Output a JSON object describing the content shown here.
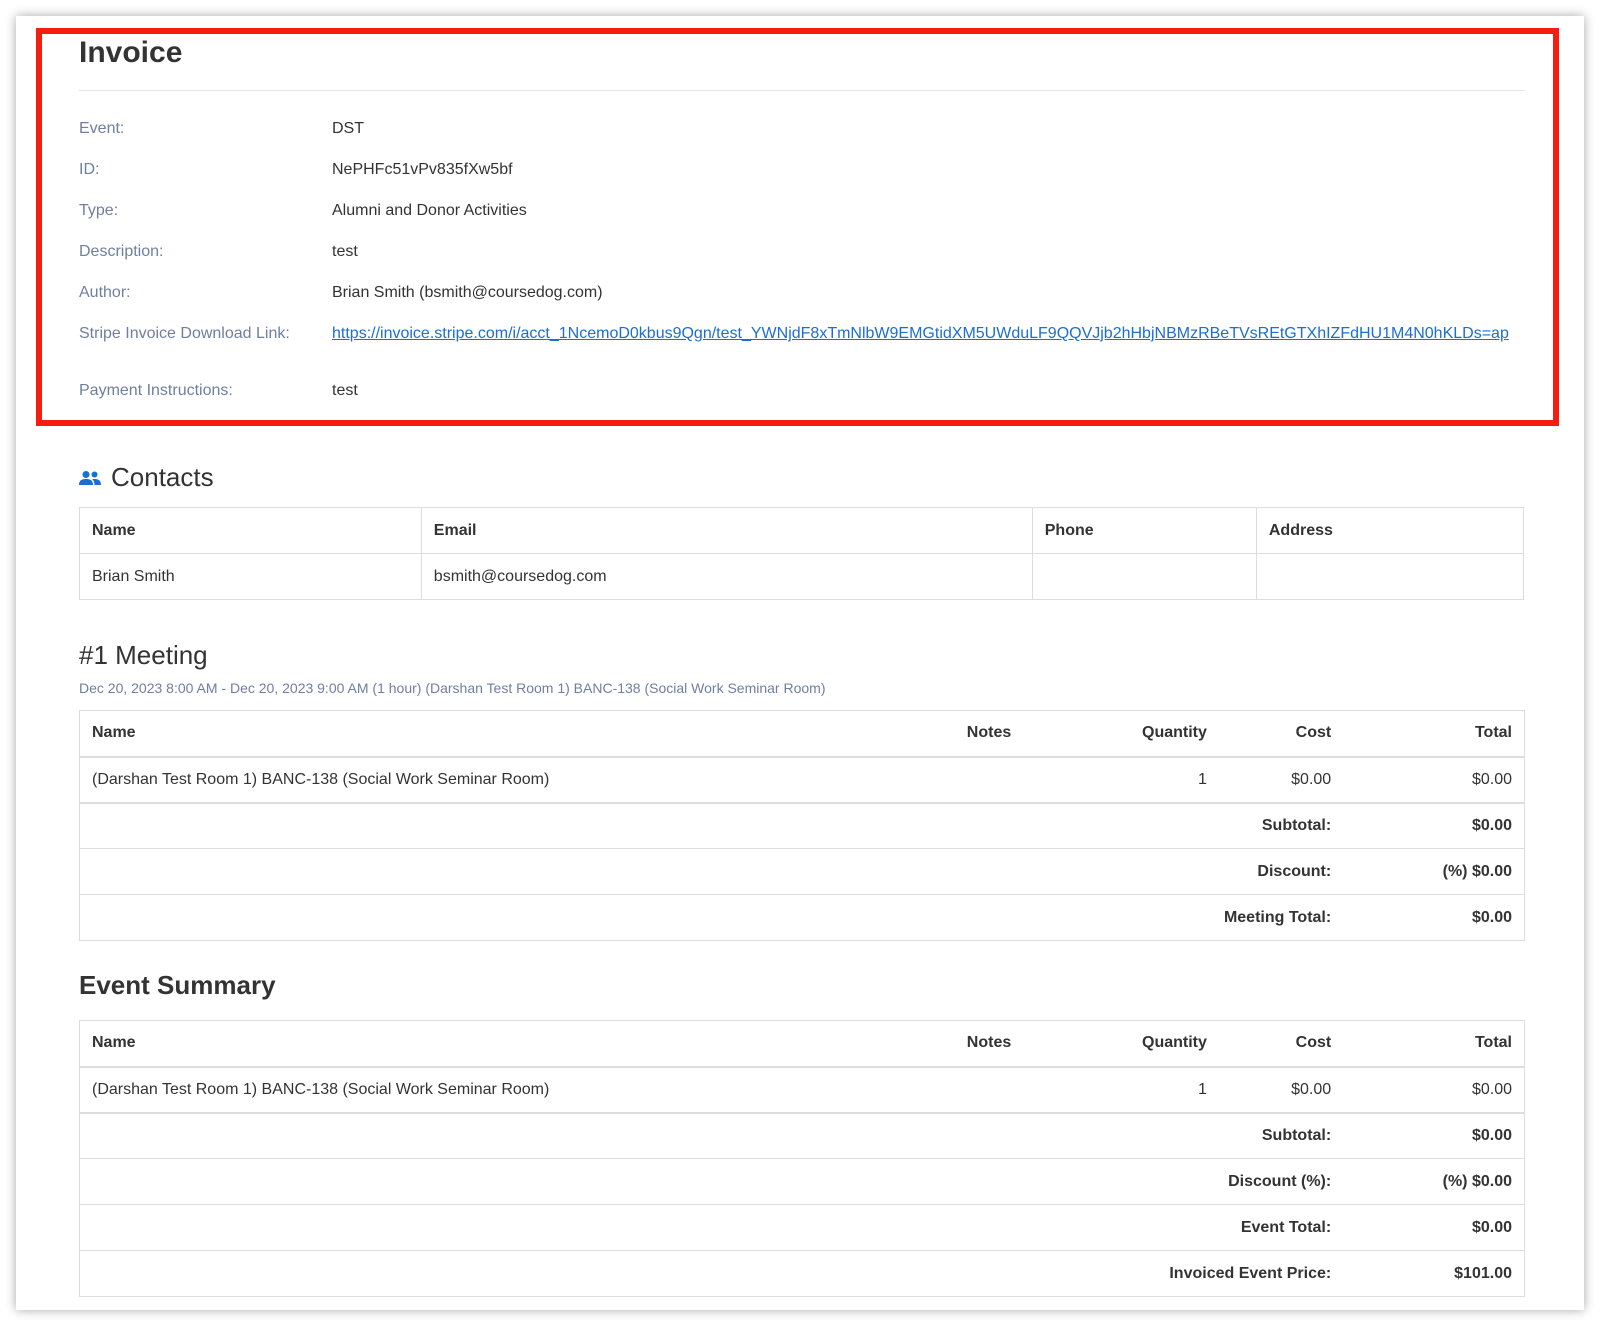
{
  "invoice": {
    "title": "Invoice",
    "fields": [
      {
        "label": "Event:",
        "value": "DST"
      },
      {
        "label": "ID:",
        "value": "NePHFc51vPv835fXw5bf"
      },
      {
        "label": "Type:",
        "value": "Alumni and Donor Activities"
      },
      {
        "label": "Description:",
        "value": "test"
      },
      {
        "label": "Author:",
        "value": "Brian Smith (bsmith@coursedog.com)"
      },
      {
        "label": "Stripe Invoice Download Link:",
        "value": "https://invoice.stripe.com/i/acct_1NcemoD0kbus9Qgn/test_YWNjdF8xTmNlbW9EMGtidXM5UWduLF9QQVJjb2hHbjNBMzRBeTVsREtGTXhIZFdHU1M4N0hKLDs=ap"
      },
      {
        "label": "Payment Instructions:",
        "value": "test"
      }
    ],
    "highlight_color": "#f51d10"
  },
  "contacts": {
    "heading": "Contacts",
    "icon": "people-icon",
    "headers": [
      "Name",
      "Email",
      "Phone",
      "Address"
    ],
    "rows": [
      [
        "Brian Smith",
        "bsmith@coursedog.com",
        "",
        ""
      ]
    ]
  },
  "meeting": {
    "heading": "#1 Meeting",
    "subtitle": "Dec 20, 2023 8:00 AM - Dec 20, 2023 9:00 AM (1 hour) (Darshan Test Room 1) BANC-138 (Social Work Seminar Room)",
    "headers": [
      "Name",
      "Notes",
      "Quantity",
      "Cost",
      "Total"
    ],
    "rows": [
      [
        "(Darshan Test Room 1) BANC-138 (Social Work Seminar Room)",
        "",
        "1",
        "$0.00",
        "$0.00"
      ]
    ],
    "summary": [
      {
        "label": "Subtotal:",
        "value": "$0.00"
      },
      {
        "label": "Discount:",
        "value": "(%) $0.00"
      },
      {
        "label": "Meeting Total:",
        "value": "$0.00"
      }
    ]
  },
  "event_summary": {
    "heading": "Event Summary",
    "headers": [
      "Name",
      "Notes",
      "Quantity",
      "Cost",
      "Total"
    ],
    "rows": [
      [
        "(Darshan Test Room 1) BANC-138 (Social Work Seminar Room)",
        "",
        "1",
        "$0.00",
        "$0.00"
      ]
    ],
    "summary": [
      {
        "label": "Subtotal:",
        "value": "$0.00"
      },
      {
        "label": "Discount (%):",
        "value": "(%) $0.00"
      },
      {
        "label": "Event Total:",
        "value": "$0.00"
      },
      {
        "label": "Invoiced Event Price:",
        "value": "$101.00"
      }
    ]
  }
}
